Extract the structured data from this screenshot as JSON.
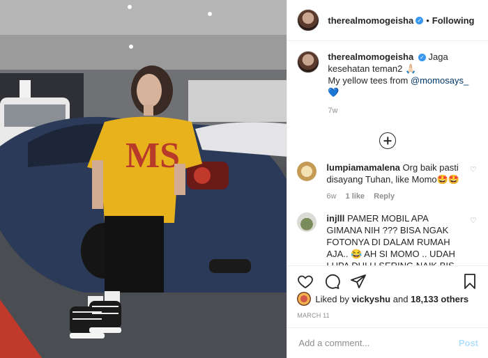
{
  "header": {
    "username": "therealmomogeisha",
    "follow_label": "Following",
    "separator": "•"
  },
  "caption": {
    "username": "therealmomogeisha",
    "text_part1": "Jaga kesehatan teman2 🙏🏻",
    "text_part2": "My yellow tees from",
    "mention": "@momosays_",
    "heart": "💙",
    "time": "7w"
  },
  "comments": [
    {
      "username": "lumpiamamalena",
      "text": "Org baik pasti disayang Tuhan, like Momo🤩🤩",
      "time": "6w",
      "likes": "1 like",
      "reply": "Reply"
    },
    {
      "username": "injlll",
      "text": "PAMER MOBIL APA GIMANA NIH ??? BISA NGAK FOTONYA DI DALAM RUMAH AJA.. 😂 AH SI MOMO .. UDAH LUPA DULU SERING NAIK BIS.. KERINGATAN.."
    }
  ],
  "likes": {
    "prefix": "Liked by",
    "user": "vickyshu",
    "middle": "and",
    "count": "18,133 others"
  },
  "date": "MARCH 11",
  "add_comment": {
    "placeholder": "Add a comment...",
    "post_label": "Post"
  },
  "colors": {
    "shirt": "#e8b21c",
    "car": "#2a3a5a",
    "link": "#00376b",
    "verified": "#3897f0"
  }
}
